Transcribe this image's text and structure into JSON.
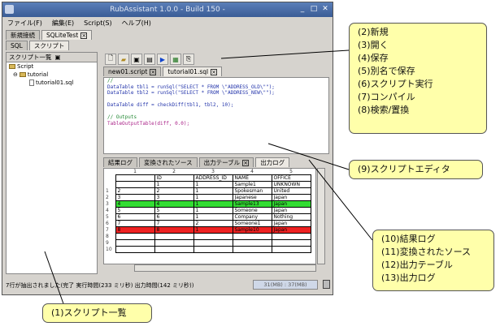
{
  "window": {
    "title": "RubAssistant 1.0.0 - Build 150 -",
    "controls": [
      "_",
      "□",
      "✕"
    ]
  },
  "menu": [
    "ファイル(F)",
    "編集(E)",
    "Script(S)",
    "ヘルプ(H)"
  ],
  "top_tabs": [
    {
      "label": "新規接続",
      "active": false
    },
    {
      "label": "SQLiteTest",
      "active": true
    }
  ],
  "sub_tabs": [
    {
      "label": "SQL",
      "active": false
    },
    {
      "label": "スクリプト",
      "active": true
    }
  ],
  "script_list": {
    "header": "スクリプト一覧",
    "items": [
      "Script",
      "tutorial",
      "tutorial01.sql"
    ]
  },
  "toolbar": [
    "new-icon",
    "open-icon",
    "save-icon",
    "save-as-icon",
    "run-icon",
    "compile-icon",
    "find-replace-icon"
  ],
  "editor_tabs": [
    "new01.script",
    "tutorial01.sql"
  ],
  "code": [
    {
      "text": "//",
      "color": "#228833"
    },
    {
      "text": "DataTable tbl1 = runSql(\"SELECT * FROM \\\"ADDRESS_OLD\\\"\");",
      "color": "#2233aa"
    },
    {
      "text": "DataTable tbl2 = runSql(\"SELECT * FROM \\\"ADDRESS_NEW\\\"\");",
      "color": "#2233aa"
    },
    {
      "text": "",
      "color": "#000000"
    },
    {
      "text": "DataTable diff = checkDiff(tbl1, tbl2, 10);",
      "color": "#2233aa"
    },
    {
      "text": "",
      "color": "#000000"
    },
    {
      "text": "// Outputs",
      "color": "#228833"
    },
    {
      "text": "TableOutputTable(diff, 0.0);",
      "color": "#aa2288"
    },
    {
      "text": "",
      "color": "#000000"
    }
  ],
  "result_tabs": [
    "結果ログ",
    "変換されたソース",
    "出力テーブル",
    "出力ログ"
  ],
  "grid": {
    "columns": [
      "1",
      "2",
      "3",
      "4",
      "5"
    ],
    "header": [
      "",
      "ID",
      "ADDRESS_ID",
      "NAME",
      "OFFICE"
    ],
    "rows": [
      {
        "n": "",
        "cells": [
          "",
          "1",
          "1",
          "Sample1",
          "UNKNOWN"
        ],
        "bg": "#ffffff"
      },
      {
        "n": "1",
        "cells": [
          "2",
          "2",
          "1",
          "Spokesman",
          "United"
        ],
        "bg": "#ffffff"
      },
      {
        "n": "2",
        "cells": [
          "3",
          "3",
          "1",
          "Japanese",
          "Japan"
        ],
        "bg": "#ffffff"
      },
      {
        "n": "3",
        "cells": [
          "4",
          "4",
          "1",
          "Sample13",
          "Japan"
        ],
        "bg": "#33dd33"
      },
      {
        "n": "4",
        "cells": [
          "5",
          "5",
          "1",
          "Someone",
          "Japan"
        ],
        "bg": "#ffffff"
      },
      {
        "n": "5",
        "cells": [
          "6",
          "6",
          "1",
          "Company",
          "Nothing"
        ],
        "bg": "#ffffff"
      },
      {
        "n": "6",
        "cells": [
          "7",
          "7",
          "2",
          "Someone1",
          "Japan"
        ],
        "bg": "#ffffff"
      },
      {
        "n": "7",
        "cells": [
          "8",
          "8",
          "1",
          "Sample10",
          "Japan"
        ],
        "bg": "#ee2222"
      },
      {
        "n": "8",
        "cells": [
          "",
          "",
          "",
          "",
          ""
        ],
        "bg": "#ffffff"
      },
      {
        "n": "9",
        "cells": [
          "",
          "",
          "",
          "",
          ""
        ],
        "bg": "#ffffff"
      },
      {
        "n": "10",
        "cells": [
          "",
          "",
          "",
          "",
          ""
        ],
        "bg": "#ffffff"
      }
    ]
  },
  "status": {
    "left": "7行が抽出されました(完了 実行時間(233 ミリ秒) 出力時間(142 ミリ秒))",
    "memory": "31(MB) : 37(MB)"
  },
  "callouts": {
    "toolbar_list": [
      "(2)新規",
      "(3)開く",
      "(4)保存",
      "(5)別名で保存",
      "(6)スクリプト実行",
      "(7)コンパイル",
      "(8)検索/置換"
    ],
    "editor": "(9)スクリプトエディタ",
    "results": [
      "(10)結果ログ",
      "(11)変換されたソース",
      "(12)出力テーブル",
      "(13)出力ログ"
    ],
    "script_list": "(1)スクリプト一覧"
  },
  "colors": {
    "title_bar": "#3a5c96",
    "callout_bg": "#ffffaa",
    "diff_added": "#33dd33",
    "diff_removed": "#ee2222",
    "run_icon": "#1144cc"
  }
}
